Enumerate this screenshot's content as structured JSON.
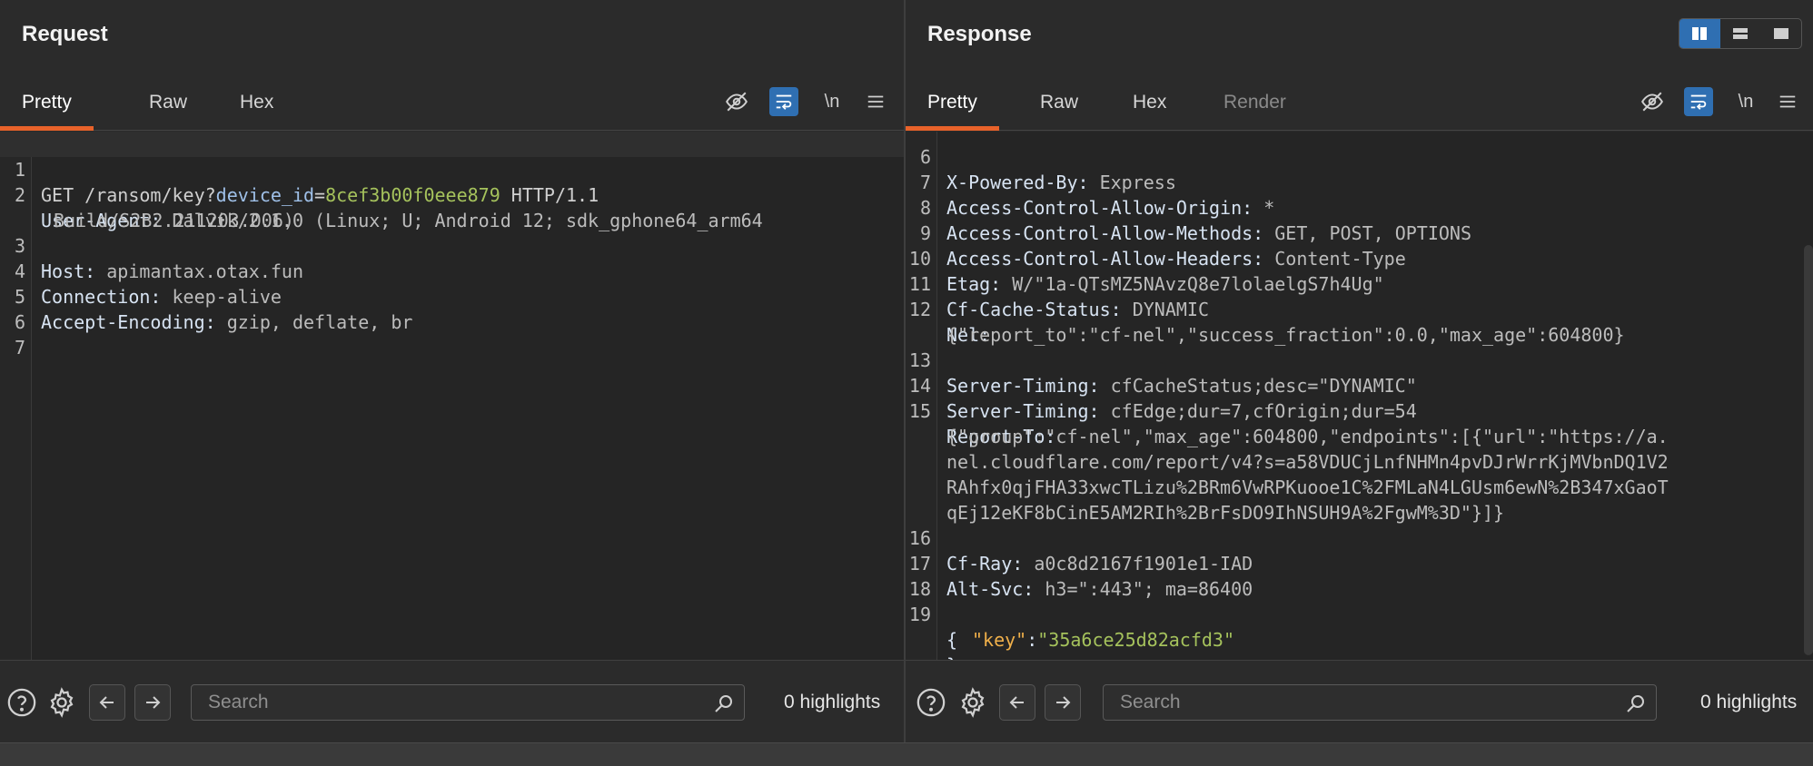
{
  "request": {
    "title": "Request",
    "tabs": [
      {
        "label": "Pretty",
        "active": true
      },
      {
        "label": "Raw",
        "active": false
      },
      {
        "label": "Hex",
        "active": false
      }
    ],
    "toolbar": {
      "hide_icon": "eye-slash-icon",
      "wrap_icon": "wrap-lines-icon",
      "newline_label": "\\n",
      "menu_icon": "hamburger-menu-icon"
    },
    "lines": [
      {
        "n": "1",
        "method": "GET",
        "path": "/ransom/key?",
        "param": "device_id",
        "eq": "=",
        "value": "8cef3b00f0eee879",
        "proto": " HTTP/1.1"
      },
      {
        "n": "2",
        "key": "User-Agent:",
        "val": " Dalvik/2.1.0 (Linux; U; Android 12; sdk_gphone64_arm64",
        "cont": "Build/S2B2.211203.006)"
      },
      {
        "n": "3",
        "key": "Host:",
        "val": " apimantax.otax.fun"
      },
      {
        "n": "4",
        "key": "Connection:",
        "val": " keep-alive"
      },
      {
        "n": "5",
        "key": "Accept-Encoding:",
        "val": " gzip, deflate, br"
      },
      {
        "n": "6"
      },
      {
        "n": "7"
      }
    ],
    "search": {
      "placeholder": "Search"
    },
    "highlights": "0 highlights"
  },
  "response": {
    "title": "Response",
    "tabs": [
      {
        "label": "Pretty",
        "active": true
      },
      {
        "label": "Raw",
        "active": false
      },
      {
        "label": "Hex",
        "active": false
      },
      {
        "label": "Render",
        "active": false,
        "disabled": true
      }
    ],
    "toolbar": {
      "hide_icon": "eye-slash-icon",
      "wrap_icon": "wrap-lines-icon",
      "newline_label": "\\n",
      "menu_icon": "hamburger-menu-icon"
    },
    "lines": [
      {
        "n": "6",
        "key": "X-Powered-By:",
        "val": " Express"
      },
      {
        "n": "7",
        "key": "Access-Control-Allow-Origin:",
        "val": " *"
      },
      {
        "n": "8",
        "key": "Access-Control-Allow-Methods:",
        "val": " GET, POST, OPTIONS"
      },
      {
        "n": "9",
        "key": "Access-Control-Allow-Headers:",
        "val": " Content-Type"
      },
      {
        "n": "10",
        "key": "Etag:",
        "val": " W/\"1a-QTsMZ5NAvzQ8e7lolaelgS7h4Ug\""
      },
      {
        "n": "11",
        "key": "Cf-Cache-Status:",
        "val": " DYNAMIC"
      },
      {
        "n": "12",
        "key": "Nel:",
        "cont": "{\"report_to\":\"cf-nel\",\"success_fraction\":0.0,\"max_age\":604800}"
      },
      {
        "n": "13",
        "key": "Server-Timing:",
        "val": " cfCacheStatus;desc=\"DYNAMIC\""
      },
      {
        "n": "14",
        "key": "Server-Timing:",
        "val": " cfEdge;dur=7,cfOrigin;dur=54"
      },
      {
        "n": "15",
        "key": "Report-To:",
        "cont": "{\"group\":\"cf-nel\",\"max_age\":604800,\"endpoints\":[{\"url\":\"https://a.",
        "cont2": "nel.cloudflare.com/report/v4?s=a58VDUCjLnfNHMn4pvDJrWrrKjMVbnDQ1V2",
        "cont3": "RAhfx0qjFHA33xwcTLizu%2BRm6VwRPKuooe1C%2FMLaN4LGUsm6ewN%2B347xGaoT",
        "cont4": "qEj12eKF8bCinE5AM2RIh%2BrFsDO9IhNSUH9A%2FgwM%3D\"}]}"
      },
      {
        "n": "16",
        "key": "Cf-Ray:",
        "val": " a0c8d2167f1901e1-IAD"
      },
      {
        "n": "17",
        "key": "Alt-Svc:",
        "val": " h3=\":443\"; ma=86400"
      },
      {
        "n": "18"
      },
      {
        "n": "19",
        "brace": "{"
      },
      {
        "json_key": "\"key\"",
        "colon": ":",
        "json_val": "\"35a6ce25d82acfd3\""
      },
      {
        "brace": "}"
      }
    ],
    "search": {
      "placeholder": "Search"
    },
    "highlights": "0 highlights"
  },
  "view_toggle": [
    "split-horizontal-icon",
    "split-vertical-icon",
    "single-pane-icon"
  ],
  "colors": {
    "accent_tab": "#e8622a",
    "toggle_on": "#2f6fb2",
    "param_value": "#a5c25c",
    "json_key": "#f0b04a"
  }
}
